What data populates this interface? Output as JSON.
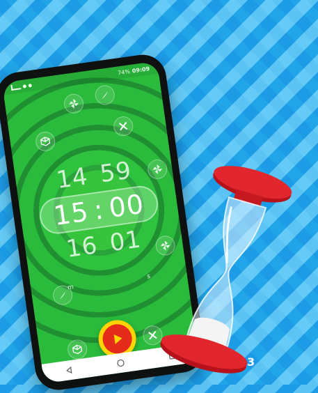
{
  "page_number": "3",
  "phone": {
    "status_bar": {
      "time": "09:09",
      "battery": "74%"
    },
    "timer": {
      "above": {
        "minutes": "14",
        "seconds": "59"
      },
      "selected": {
        "minutes": "15",
        "seconds": "00"
      },
      "below": {
        "minutes": "16",
        "seconds": "01"
      },
      "unit_labels": {
        "minutes": "m",
        "seconds": "s"
      }
    },
    "play_button_icon": "play-icon",
    "nav_icons": [
      "back-icon",
      "home-icon",
      "recents-icon"
    ],
    "decor_icons": [
      "pinwheel-icon",
      "feather-icon",
      "tools-icon",
      "cube-icon"
    ]
  },
  "colors": {
    "background_blue": "#1d9be6",
    "screen_green": "#2bbb3c",
    "play_yellow": "#ffd400",
    "play_red": "#e52b1b",
    "hourglass_red": "#d9232a"
  }
}
